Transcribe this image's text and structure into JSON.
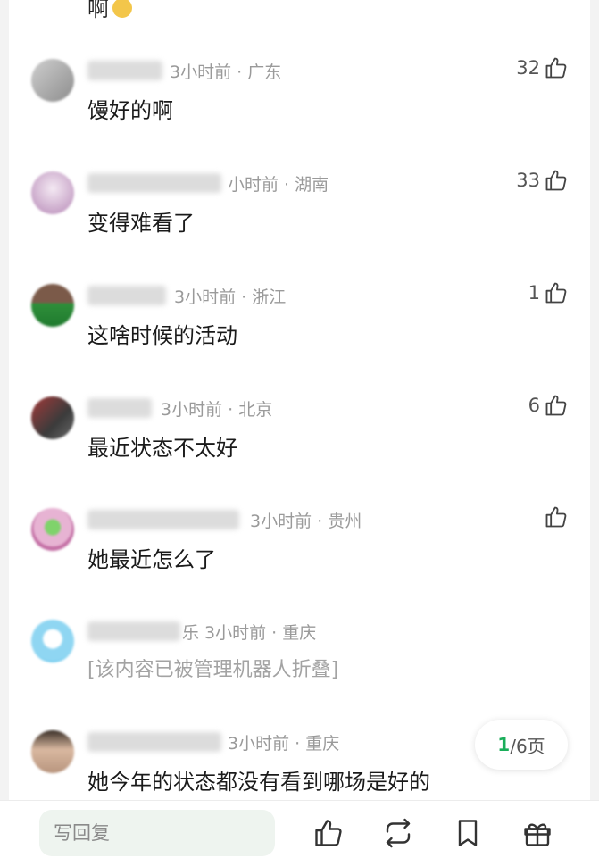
{
  "top_fragment": {
    "text": "啊",
    "emoji": "smiley-emoji"
  },
  "comments": [
    {
      "meta": "3小时前 · 广东",
      "text": "馒好的啊",
      "likes": "32"
    },
    {
      "meta": "小时前 · 湖南",
      "text": "变得难看了",
      "likes": "33"
    },
    {
      "meta": "3小时前 · 浙江",
      "text": "这啥时候的活动",
      "likes": "1"
    },
    {
      "meta": "3小时前 · 北京",
      "text": "最近状态不太好",
      "likes": "6"
    },
    {
      "meta": "3小时前 · 贵州",
      "text": "她最近怎么了",
      "likes": ""
    },
    {
      "meta": "乐 3小时前 · 重庆",
      "text": "[该内容已被管理机器人折叠]",
      "likes": ""
    },
    {
      "meta": "3小时前 · 重庆",
      "text": "她今年的状态都没有看到哪场是好的",
      "likes": ""
    }
  ],
  "pager": {
    "current": "1",
    "rest": "/6页"
  },
  "bottom_bar": {
    "reply_placeholder": "写回复",
    "icons": [
      "thumbs-up-icon",
      "repost-icon",
      "bookmark-icon",
      "gift-icon"
    ]
  },
  "colors": {
    "accent": "#1aae5a",
    "meta_gray": "#9a9a9a",
    "folded_gray": "#a3a3a3"
  }
}
